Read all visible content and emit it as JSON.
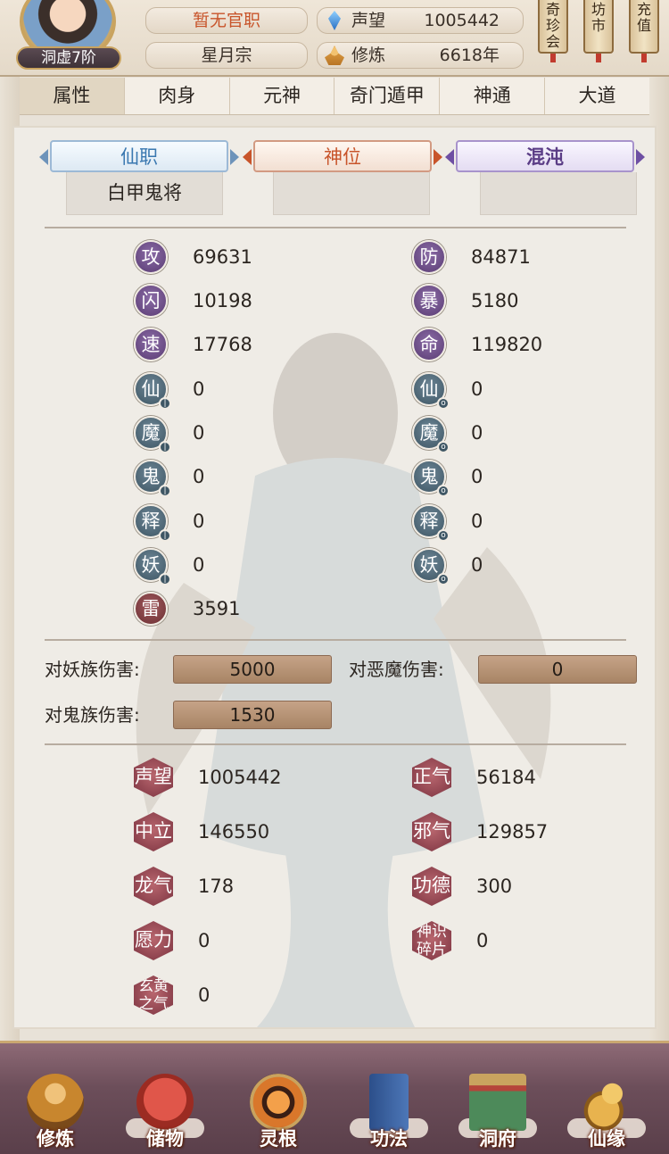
{
  "header": {
    "realm": "洞虚7阶",
    "official_rank": "暂无官职",
    "sect": "星月宗",
    "fame_label": "声望",
    "fame_value": "1005442",
    "cultivation_label": "修炼",
    "cultivation_value": "6618年",
    "side_buttons": [
      {
        "label": "奇\n珍\n会"
      },
      {
        "label": "坊\n市"
      },
      {
        "label": "充\n值"
      }
    ]
  },
  "tabs": [
    "属性",
    "肉身",
    "元神",
    "奇门遁甲",
    "神通",
    "大道"
  ],
  "active_tab": 0,
  "ranks": {
    "immortal_post_label": "仙职",
    "immortal_post_value": "白甲鬼将",
    "divine_seat_label": "神位",
    "divine_seat_value": "",
    "chaos_label": "混沌",
    "chaos_value": ""
  },
  "stats_left": [
    {
      "icon": "攻",
      "value": "69631",
      "style": "purple"
    },
    {
      "icon": "闪",
      "value": "10198",
      "style": "purple"
    },
    {
      "icon": "速",
      "value": "17768",
      "style": "purple"
    },
    {
      "icon": "仙",
      "value": "0",
      "style": "slate"
    },
    {
      "icon": "魔",
      "value": "0",
      "style": "slate"
    },
    {
      "icon": "鬼",
      "value": "0",
      "style": "slate"
    },
    {
      "icon": "释",
      "value": "0",
      "style": "slate"
    },
    {
      "icon": "妖",
      "value": "0",
      "style": "slate"
    },
    {
      "icon": "雷",
      "value": "3591",
      "style": "maroon"
    }
  ],
  "stats_right": [
    {
      "icon": "防",
      "value": "84871",
      "style": "purple"
    },
    {
      "icon": "暴",
      "value": "5180",
      "style": "purple"
    },
    {
      "icon": "命",
      "value": "119820",
      "style": "purple"
    },
    {
      "icon": "仙",
      "value": "0",
      "style": "slate"
    },
    {
      "icon": "魔",
      "value": "0",
      "style": "slate"
    },
    {
      "icon": "鬼",
      "value": "0",
      "style": "slate"
    },
    {
      "icon": "释",
      "value": "0",
      "style": "slate"
    },
    {
      "icon": "妖",
      "value": "0",
      "style": "slate"
    }
  ],
  "damage": {
    "vs_demon_race_label": "对妖族伤害:",
    "vs_demon_race_value": "5000",
    "vs_evil_demon_label": "对恶魔伤害:",
    "vs_evil_demon_value": "0",
    "vs_ghost_race_label": "对鬼族伤害:",
    "vs_ghost_race_value": "1530"
  },
  "misc_left": [
    {
      "icon": "声望",
      "value": "1005442"
    },
    {
      "icon": "中立",
      "value": "146550"
    },
    {
      "icon": "龙气",
      "value": "178"
    },
    {
      "icon": "愿力",
      "value": "0"
    },
    {
      "icon": "玄黄之气",
      "value": "0"
    }
  ],
  "misc_right": [
    {
      "icon": "正气",
      "value": "56184"
    },
    {
      "icon": "邪气",
      "value": "129857"
    },
    {
      "icon": "功德",
      "value": "300"
    },
    {
      "icon": "神识碎片",
      "value": "0"
    }
  ],
  "bottom_nav": [
    {
      "label": "修炼",
      "icon": "monk-icon"
    },
    {
      "label": "储物",
      "icon": "bag-icon"
    },
    {
      "label": "灵根",
      "icon": "spirit-root-icon"
    },
    {
      "label": "功法",
      "icon": "scroll-book-icon"
    },
    {
      "label": "洞府",
      "icon": "cave-house-icon"
    },
    {
      "label": "仙缘",
      "icon": "gourd-icon"
    }
  ],
  "colors": {
    "rank_red": "#c8542a",
    "stat_purple": "#5a3c74",
    "stat_slate": "#3e5664",
    "misc_maroon": "#7b3340"
  }
}
